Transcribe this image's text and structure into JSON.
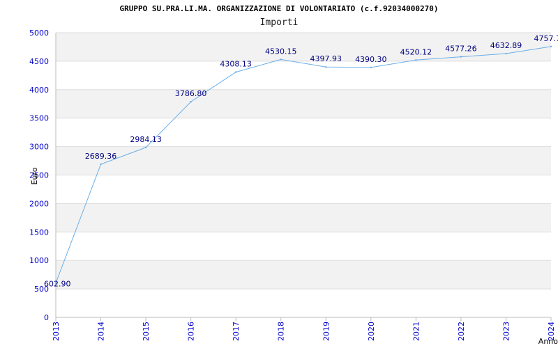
{
  "chart_data": {
    "type": "line",
    "title": "GRUPPO SU.PRA.LI.MA. ORGANIZZAZIONE DI VOLONTARIATO (c.f.92034000270)",
    "subtitle": "Importi",
    "xlabel": "Anno",
    "ylabel": "Euro",
    "x": [
      "2013",
      "2014",
      "2015",
      "2016",
      "2017",
      "2018",
      "2019",
      "2020",
      "2021",
      "2022",
      "2023",
      "2024"
    ],
    "y_ticks": [
      "0",
      "500",
      "1000",
      "1500",
      "2000",
      "2500",
      "3000",
      "3500",
      "4000",
      "4500",
      "5000"
    ],
    "ylim": [
      0,
      5000
    ],
    "series": [
      {
        "values": [
          602.9,
          2689.36,
          2984.13,
          3786.8,
          4308.13,
          4530.15,
          4397.93,
          4390.3,
          4520.12,
          4577.26,
          4632.89,
          4757.7
        ],
        "labels": [
          "602.90",
          "2689.36",
          "2984.13",
          "3786.80",
          "4308.13",
          "4530.15",
          "4397.93",
          "4390.30",
          "4520.12",
          "4577.26",
          "4632.89",
          "4757.7"
        ],
        "color": "#6aaee8"
      }
    ],
    "grid": true,
    "band_color": "#f2f2f2",
    "grid_color": "#dddddd",
    "tick_color": "#0000cc",
    "label_color": "#000080"
  }
}
